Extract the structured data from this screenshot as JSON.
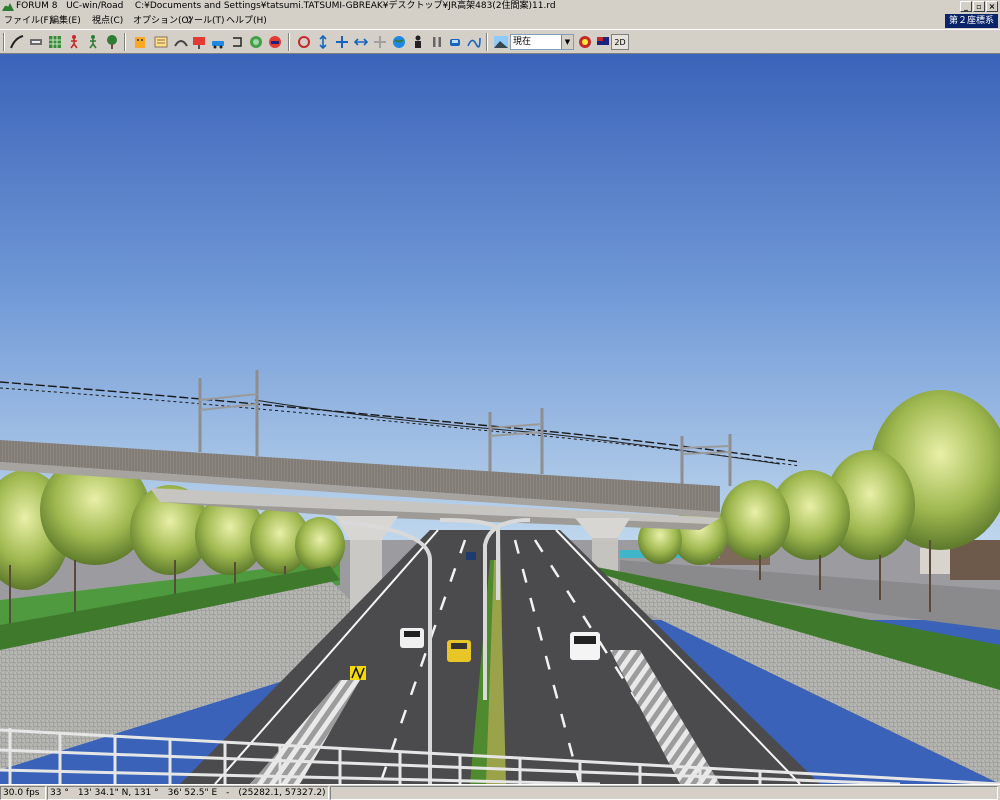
{
  "window": {
    "app_name": "FORUM 8",
    "product": "UC-win/Road",
    "file_path": "C:¥Documents and Settings¥tatsumi.TATSUMI-GBREAK¥デスクトップ¥JR高架483(2住間案)11.rd",
    "minimize_glyph": "_",
    "restore_glyph": "▫",
    "close_glyph": "×"
  },
  "menu": {
    "items": [
      "ファイル(F)",
      "編集(E)",
      "視点(C)",
      "オプション(O)",
      "ツール(T)",
      "ヘルプ(H)"
    ],
    "coordinate_system": "第２座標系"
  },
  "toolbar": {
    "time_value": "現在",
    "view_2d_label": "2D"
  },
  "status": {
    "fps": "30.0 fps",
    "coords": "33 °　13' 34.1\" N, 131 °　36' 52.5\" E　-　(25282.1, 57327.2)"
  },
  "icons": {
    "app": "forum8-logo-icon"
  }
}
